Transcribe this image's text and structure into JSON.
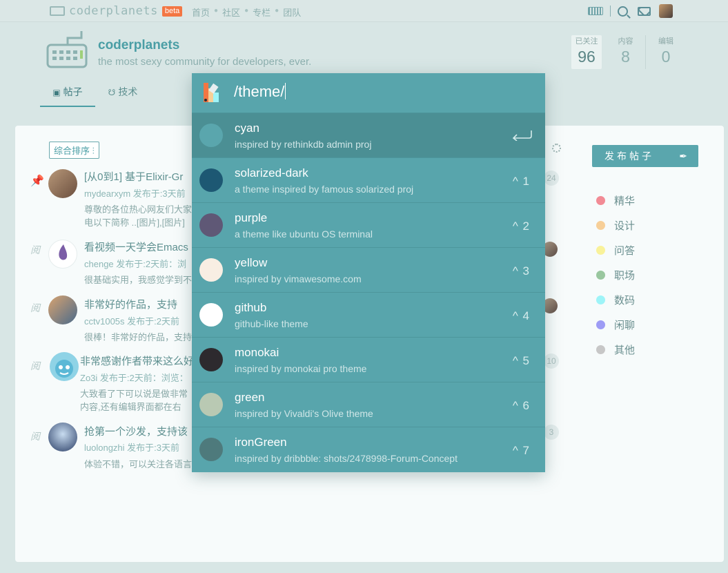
{
  "topnav": {
    "logo": "coderplanets",
    "beta": "beta",
    "links": [
      "首页",
      "社区",
      "专栏",
      "团队"
    ]
  },
  "community": {
    "title": "coderplanets",
    "desc": "the most sexy community for developers, ever.",
    "stats": [
      {
        "label": "已关注",
        "value": "96"
      },
      {
        "label": "内容",
        "value": "8"
      },
      {
        "label": "编辑",
        "value": "0"
      }
    ],
    "tabs": [
      {
        "icon": "▣",
        "label": "帖子"
      },
      {
        "icon": "☋",
        "label": "技术"
      }
    ]
  },
  "filter": "综合排序",
  "posts": [
    {
      "title": "[从0到1] 基于Elixir-Gr",
      "meta": "mydearxym 发布于:3天前",
      "body": [
        "尊敬的各位热心网友们大家",
        "电以下简称 ..[图片],[图片]"
      ],
      "count": "24"
    },
    {
      "title": "看视频一天学会Emacs",
      "meta": "chenge 发布于:2天前：浏",
      "body": [
        "很基础实用，我感觉学到不"
      ]
    },
    {
      "title": "非常好的作品，支持",
      "meta": "cctv1005s 发布于:2天前",
      "body": [
        "很棒！非常好的作品，支持"
      ]
    },
    {
      "title": "非常感谢作者带来这么好",
      "meta": "Zo3i 发布于:2天前：浏览：",
      "body": [
        "大致看了下可以说是做非常",
        "内容,还有编辑界面都在右"
      ],
      "count": "10"
    },
    {
      "title": "抢第一个沙发，支持该",
      "meta": "luolongzhi 发布于:3天前",
      "body": [
        "体验不错，可以关注各语言"
      ],
      "count": "3"
    }
  ],
  "publish": "发布帖子",
  "categories": [
    {
      "name": "精华",
      "color": "#f28b95"
    },
    {
      "name": "设计",
      "color": "#f7cf98"
    },
    {
      "name": "问答",
      "color": "#f9f29a"
    },
    {
      "name": "职场",
      "color": "#99c79f"
    },
    {
      "name": "数码",
      "color": "#9ef4f8"
    },
    {
      "name": "闲聊",
      "color": "#9d9cf5"
    },
    {
      "name": "其他",
      "color": "#c7c7c7"
    }
  ],
  "palette": {
    "input": "/theme/",
    "options": [
      {
        "name": "cyan",
        "desc": "inspired by rethinkdb admin proj",
        "key": "",
        "color": "#5aa6ad"
      },
      {
        "name": "solarized-dark",
        "desc": "a theme inspired by famous solarized proj",
        "key": "^ 1",
        "color": "#1d5873"
      },
      {
        "name": "purple",
        "desc": "a theme like ubuntu OS terminal",
        "key": "^ 2",
        "color": "#5f5876"
      },
      {
        "name": "yellow",
        "desc": "inspired by vimawesome.com",
        "key": "^ 3",
        "color": "#f8eee3"
      },
      {
        "name": "github",
        "desc": "github-like theme",
        "key": "^ 4",
        "color": "#ffffff"
      },
      {
        "name": "monokai",
        "desc": "inspired by monokai pro theme",
        "key": "^ 5",
        "color": "#2d2a2e"
      },
      {
        "name": "green",
        "desc": "inspired by Vivaldi's Olive theme",
        "key": "^ 6",
        "color": "#b9c9b3"
      },
      {
        "name": "ironGreen",
        "desc": "inspired by dribbble: shots/2478998-Forum-Concept",
        "key": "^ 7",
        "color": "#4e7a7c"
      }
    ]
  }
}
